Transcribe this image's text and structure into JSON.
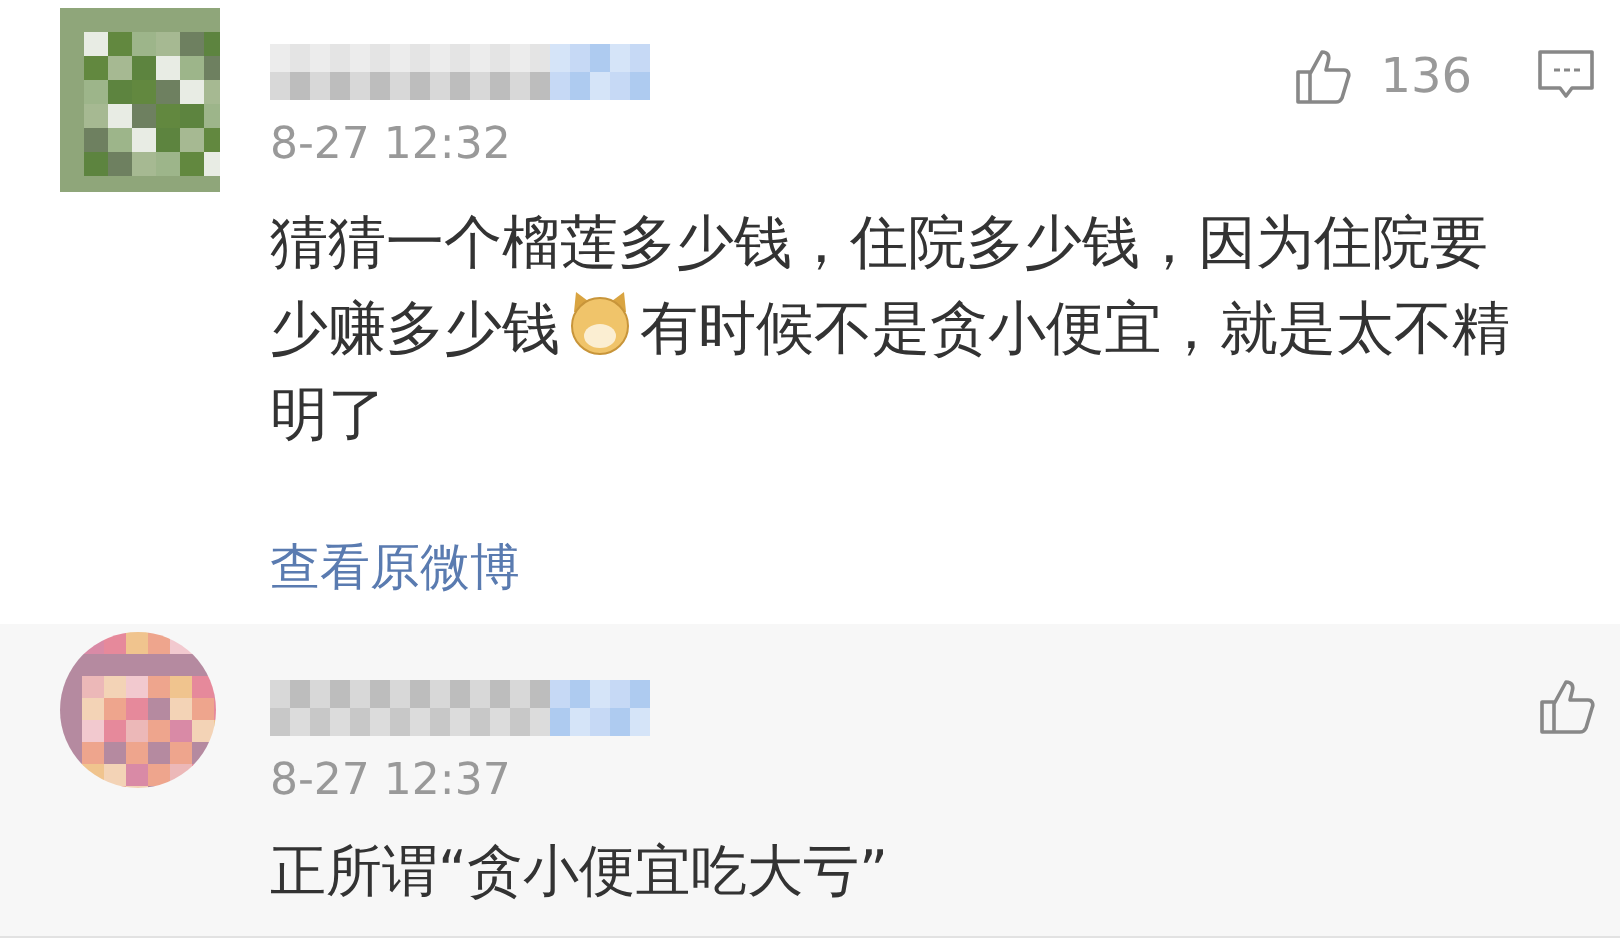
{
  "comments": [
    {
      "time": "8-27 12:32",
      "likes": "136",
      "show_reply": true,
      "lines": [
        [
          {
            "kind": "text",
            "text": "猜猜一个榴莲多少钱，住院多少钱，因为住院要"
          }
        ],
        [
          {
            "kind": "text",
            "text": "少赚多少钱"
          },
          {
            "kind": "emoji"
          },
          {
            "kind": "text",
            "text": "有时候不是贪小便宜，就是太不精"
          }
        ],
        [
          {
            "kind": "text",
            "text": "明了"
          }
        ]
      ],
      "link": "查看原微博"
    },
    {
      "time": "8-27 12:37",
      "show_reply": false,
      "lines": [
        [
          {
            "kind": "text",
            "text": "正所谓“贪小便宜吃大亏”"
          }
        ]
      ]
    }
  ]
}
